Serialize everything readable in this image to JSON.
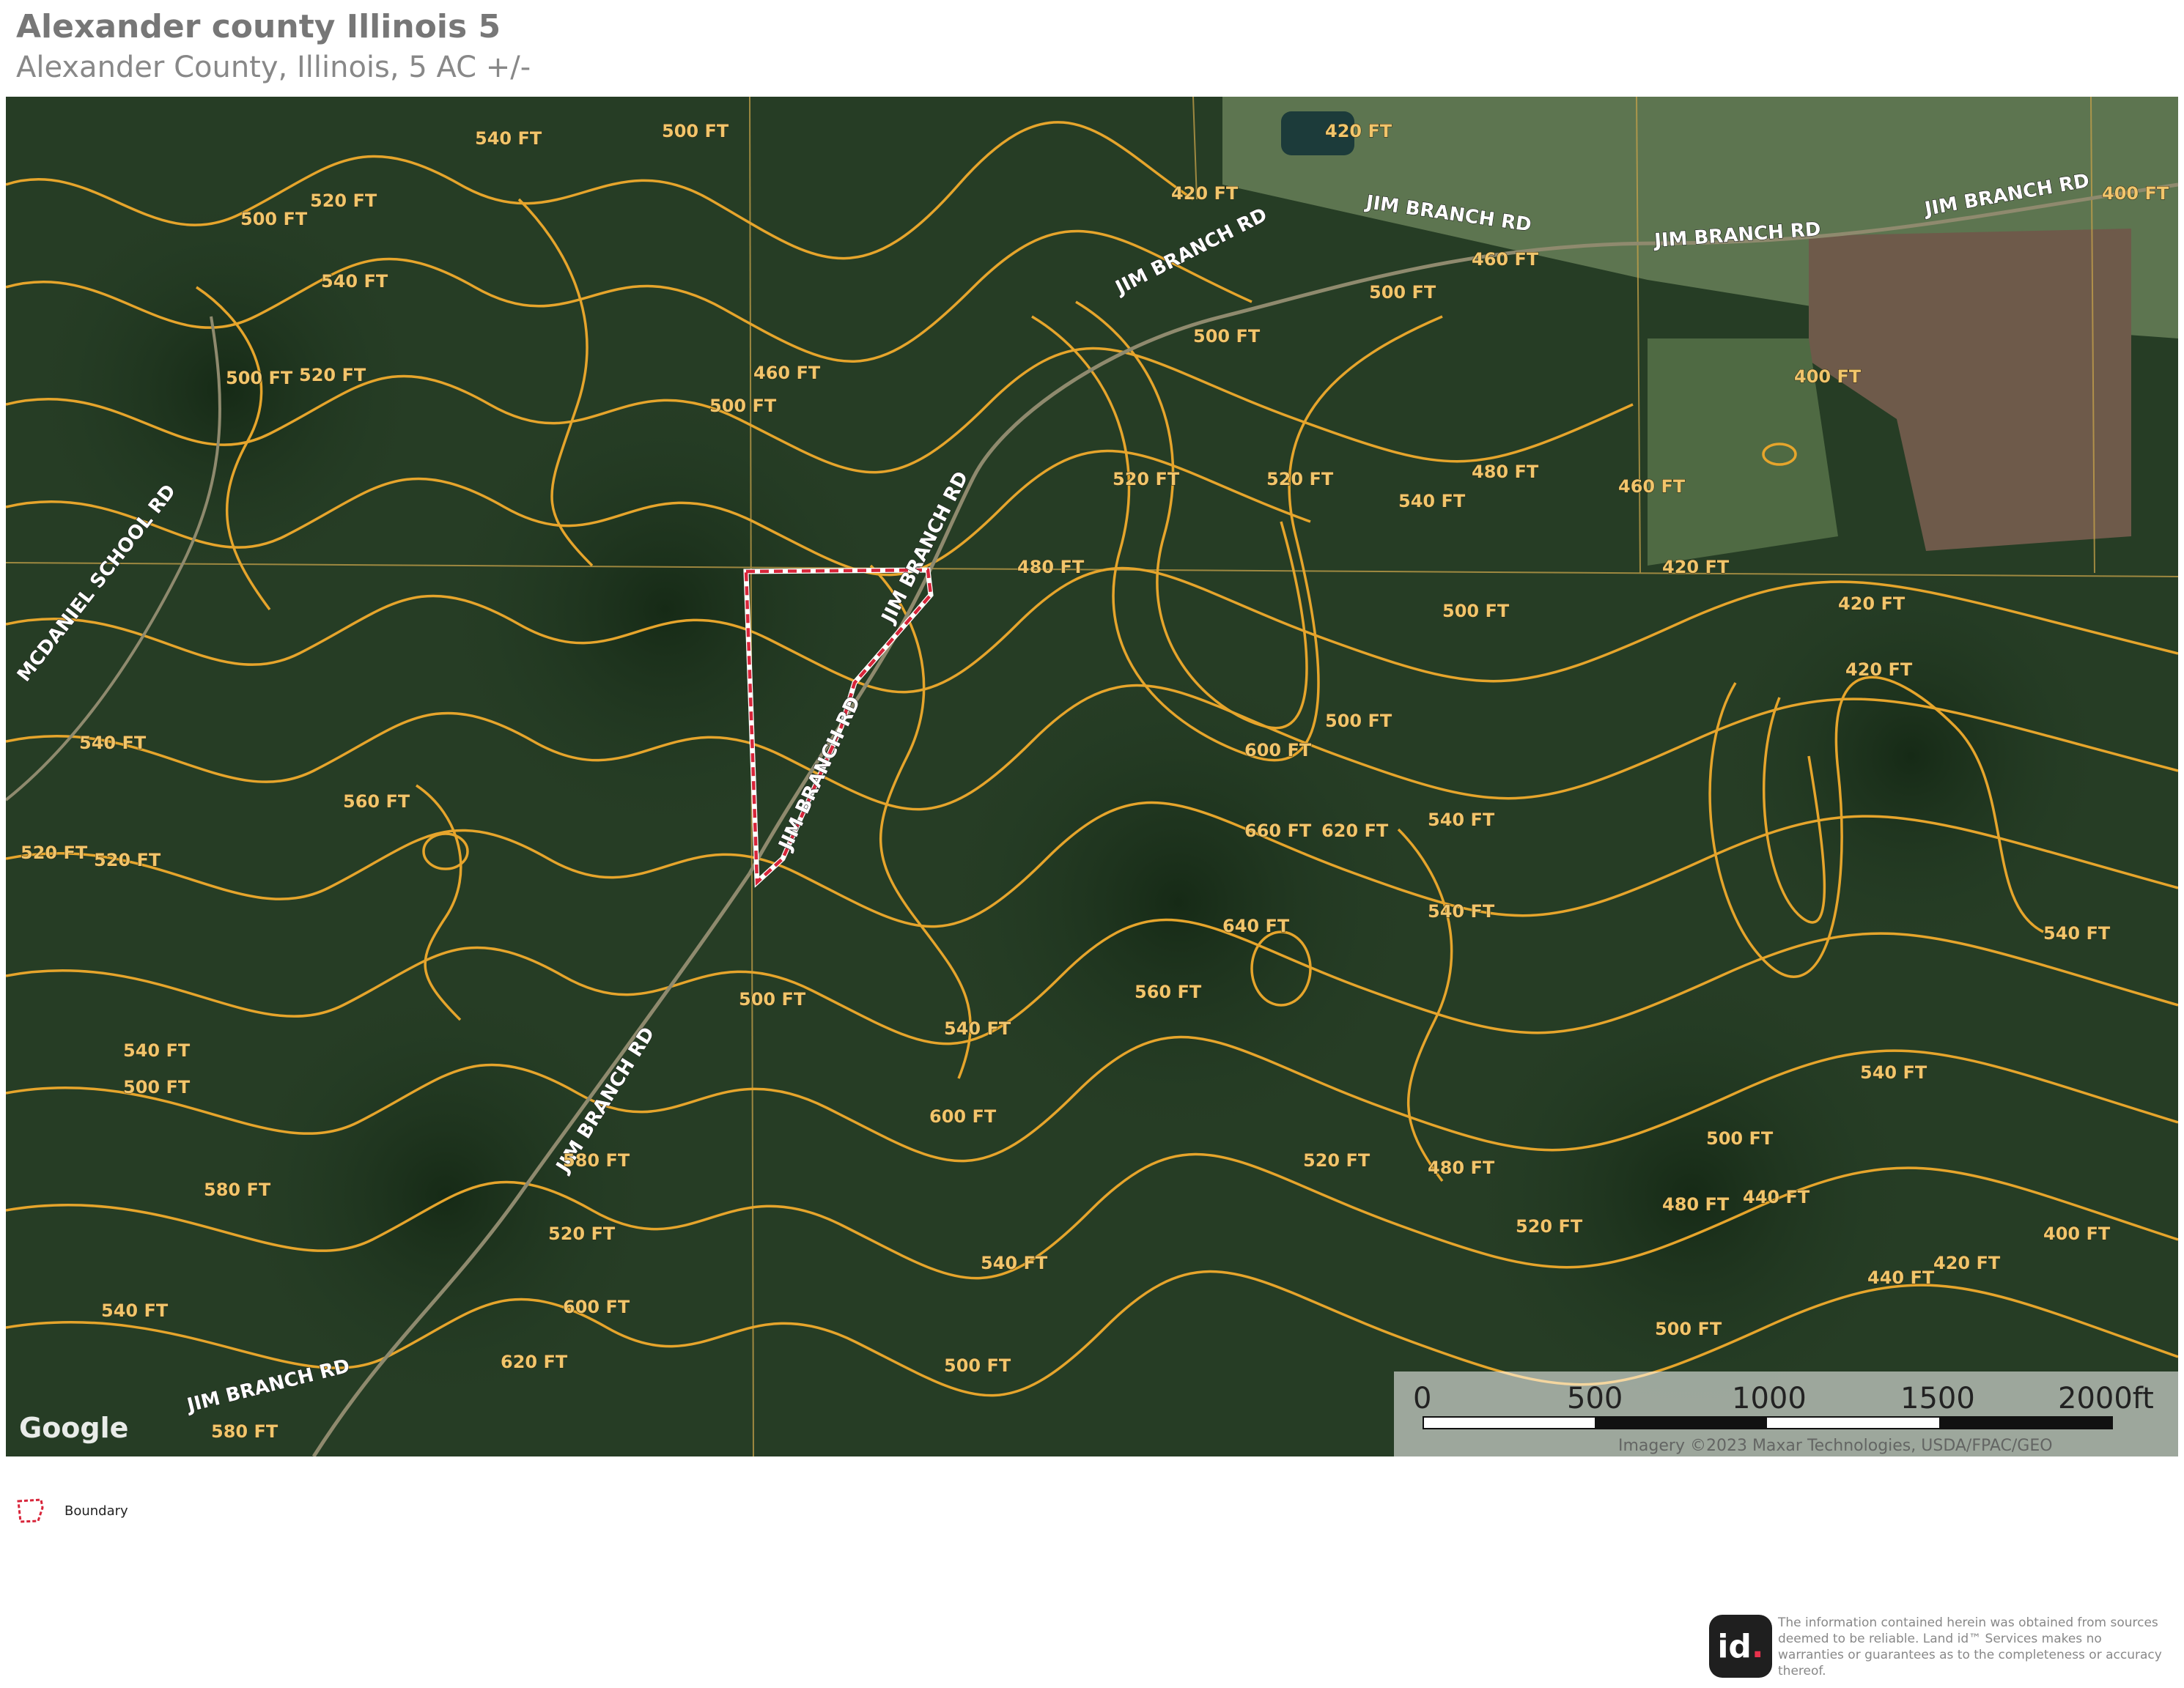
{
  "header": {
    "title": "Alexander county Illinois 5",
    "subtitle": "Alexander County, Illinois, 5 AC +/-"
  },
  "map": {
    "road_labels": [
      "JIM BRANCH RD",
      "MCDANIEL SCHOOL RD"
    ],
    "contour_labels": [
      "400 FT",
      "420 FT",
      "440 FT",
      "460 FT",
      "480 FT",
      "500 FT",
      "520 FT",
      "540 FT",
      "560 FT",
      "580 FT",
      "600 FT",
      "620 FT",
      "640 FT",
      "660 FT"
    ],
    "google_wordmark": "Google",
    "attribution": "Imagery ©2023 Maxar Technologies, USDA/FPAC/GEO",
    "scale": {
      "labels": [
        "0",
        "500",
        "1000",
        "1500",
        "2000ft"
      ]
    },
    "colors": {
      "contour": "#e6a52c",
      "boundary": "#d8253a",
      "forest": "#233a23",
      "field": "#6e5a4a"
    }
  },
  "legend": {
    "label": "Boundary",
    "icon": "boundary-polygon-icon"
  },
  "footer": {
    "logo_text": "id",
    "logo_dot": ".",
    "disclaimer": "The information contained herein was obtained from sources deemed to be reliable. Land id™ Services makes no warranties or guarantees as to the completeness or accuracy thereof."
  }
}
